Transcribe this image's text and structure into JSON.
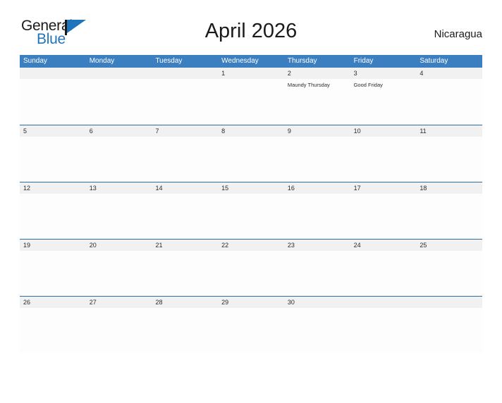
{
  "brand": {
    "name_top": "General",
    "name_bottom": "Blue",
    "accent_color": "#1f74bb"
  },
  "header": {
    "title": "April 2026",
    "subtitle": "Nicaragua"
  },
  "theme": {
    "header_blue": "#3c7fc0",
    "row_border_blue": "#2f6ca6",
    "number_band_gray": "#f1f1f1"
  },
  "calendar": {
    "weekdays": [
      "Sunday",
      "Monday",
      "Tuesday",
      "Wednesday",
      "Thursday",
      "Friday",
      "Saturday"
    ],
    "weeks": [
      {
        "days": [
          {
            "num": "",
            "events": []
          },
          {
            "num": "",
            "events": []
          },
          {
            "num": "",
            "events": []
          },
          {
            "num": "1",
            "events": []
          },
          {
            "num": "2",
            "events": [
              "Maundy Thursday"
            ]
          },
          {
            "num": "3",
            "events": [
              "Good Friday"
            ]
          },
          {
            "num": "4",
            "events": []
          }
        ]
      },
      {
        "days": [
          {
            "num": "5",
            "events": []
          },
          {
            "num": "6",
            "events": []
          },
          {
            "num": "7",
            "events": []
          },
          {
            "num": "8",
            "events": []
          },
          {
            "num": "9",
            "events": []
          },
          {
            "num": "10",
            "events": []
          },
          {
            "num": "11",
            "events": []
          }
        ]
      },
      {
        "days": [
          {
            "num": "12",
            "events": []
          },
          {
            "num": "13",
            "events": []
          },
          {
            "num": "14",
            "events": []
          },
          {
            "num": "15",
            "events": []
          },
          {
            "num": "16",
            "events": []
          },
          {
            "num": "17",
            "events": []
          },
          {
            "num": "18",
            "events": []
          }
        ]
      },
      {
        "days": [
          {
            "num": "19",
            "events": []
          },
          {
            "num": "20",
            "events": []
          },
          {
            "num": "21",
            "events": []
          },
          {
            "num": "22",
            "events": []
          },
          {
            "num": "23",
            "events": []
          },
          {
            "num": "24",
            "events": []
          },
          {
            "num": "25",
            "events": []
          }
        ]
      },
      {
        "days": [
          {
            "num": "26",
            "events": []
          },
          {
            "num": "27",
            "events": []
          },
          {
            "num": "28",
            "events": []
          },
          {
            "num": "29",
            "events": []
          },
          {
            "num": "30",
            "events": []
          },
          {
            "num": "",
            "events": []
          },
          {
            "num": "",
            "events": []
          }
        ]
      }
    ]
  }
}
